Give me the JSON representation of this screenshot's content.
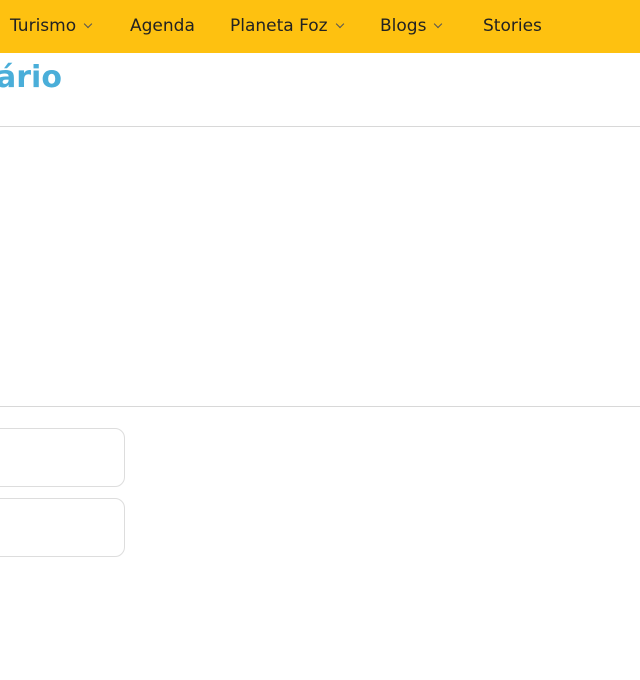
{
  "nav": {
    "items": [
      {
        "label": "Turismo",
        "has_dropdown": true
      },
      {
        "label": "Agenda",
        "has_dropdown": false
      },
      {
        "label": "Planeta Foz",
        "has_dropdown": true
      },
      {
        "label": "Blogs",
        "has_dropdown": true
      },
      {
        "label": "Stories",
        "has_dropdown": false
      }
    ]
  },
  "page": {
    "title_fragment": "ário"
  },
  "colors": {
    "nav_bg": "#fec110",
    "title": "#4aaed9"
  }
}
